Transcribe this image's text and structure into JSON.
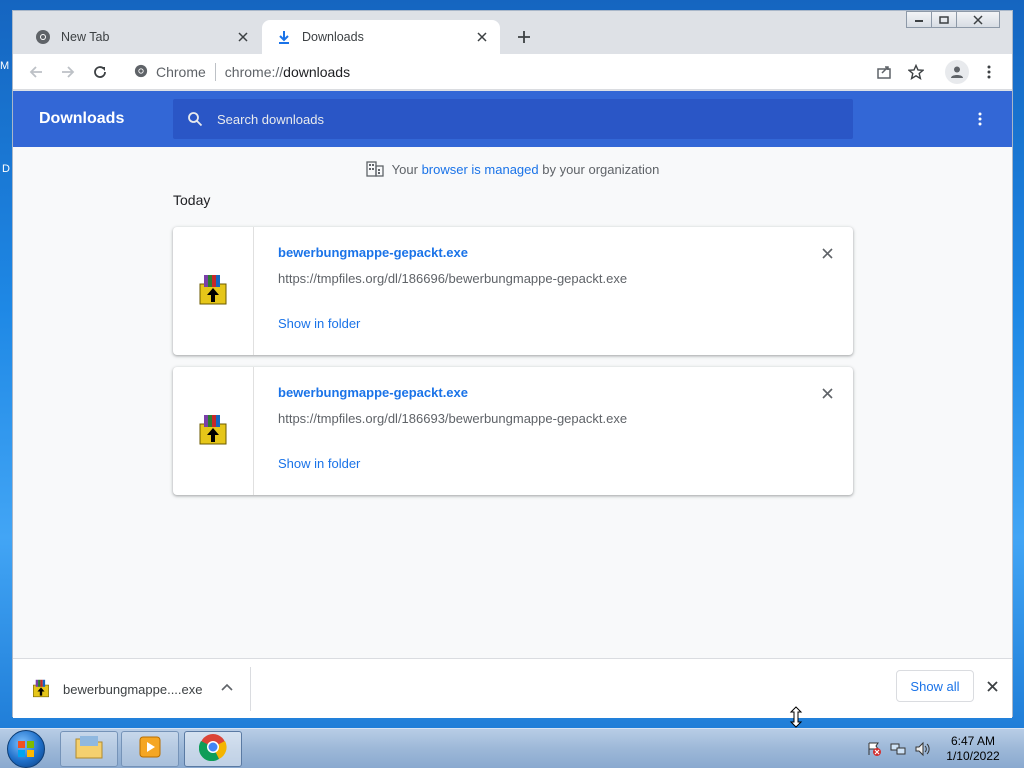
{
  "desktop": {
    "glyph_1": "M",
    "glyph_2": "D"
  },
  "tabs": [
    {
      "label": "New Tab",
      "icon": "chrome-icon",
      "active": false
    },
    {
      "label": "Downloads",
      "icon": "download-icon",
      "active": true
    }
  ],
  "toolbar": {
    "site_label": "Chrome",
    "url_scheme": "chrome://",
    "url_path": "downloads"
  },
  "downloads_page": {
    "title": "Downloads",
    "search_placeholder": "Search downloads",
    "managed_prefix": "Your ",
    "managed_link": "browser is managed",
    "managed_suffix": " by your organization",
    "section_label": "Today",
    "items": [
      {
        "filename": "bewerbungmappe-gepackt.exe",
        "url": "https://tmpfiles.org/dl/186696/bewerbungmappe-gepackt.exe",
        "action": "Show in folder"
      },
      {
        "filename": "bewerbungmappe-gepackt.exe",
        "url": "https://tmpfiles.org/dl/186693/bewerbungmappe-gepackt.exe",
        "action": "Show in folder"
      }
    ]
  },
  "shelf": {
    "item_name": "bewerbungmappe....exe",
    "show_all": "Show all"
  },
  "taskbar": {
    "time": "6:47 AM",
    "date": "1/10/2022"
  },
  "colors": {
    "header": "#3367d6",
    "link": "#1a73e8",
    "page_bg": "#f8f9fa"
  }
}
